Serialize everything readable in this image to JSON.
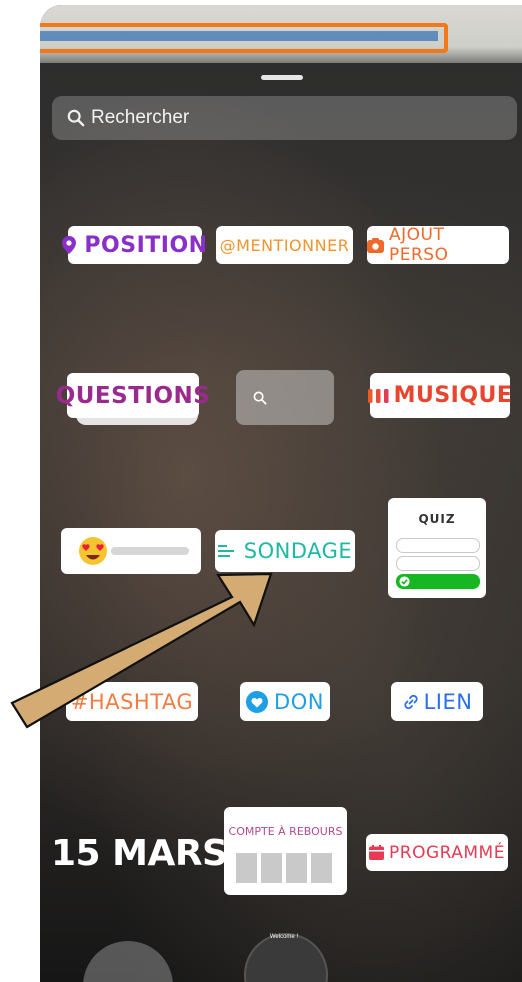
{
  "search": {
    "placeholder": "Rechercher"
  },
  "stickers": {
    "position": "POSITION",
    "mention": "@MENTIONNER",
    "ajout_perso": "AJOUT PERSO",
    "questions": "QUESTIONS",
    "musique": "MUSIQUE",
    "sondage": "SONDAGE",
    "quiz": "QUIZ",
    "hashtag": "#HASHTAG",
    "don": "DON",
    "lien": "LIEN",
    "date": "15 MARS",
    "compte_a_rebours": "COMPTE À REBOURS",
    "programme": "PROGRAMMÉ"
  },
  "bottom": {
    "avatar_caption": "Welcome !"
  },
  "colors": {
    "position": "#8a2fc7",
    "mention": "#f0952a",
    "ajout_perso": "#ef6a2a",
    "questions": "#9b2a8f",
    "musique": "#e8452f",
    "sondage": "#1fb8a4",
    "hashtag": "#f27c43",
    "don": "#1f9ee8",
    "lien": "#2a6ef0",
    "programme": "#e83a52",
    "quiz_green": "#16b722",
    "arrow": "#d3ab73"
  },
  "icons": [
    "search-icon",
    "location-pin-icon",
    "camera-icon",
    "music-bars-icon",
    "poll-lines-icon",
    "heart-eyes-emoji-icon",
    "heart-icon",
    "link-icon",
    "calendar-icon",
    "check-icon",
    "arrow-annotation"
  ]
}
